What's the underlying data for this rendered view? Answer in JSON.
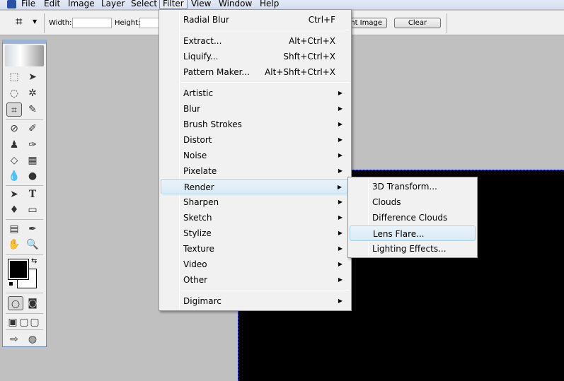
{
  "menubar": {
    "items": [
      "File",
      "Edit",
      "Image",
      "Layer",
      "Select",
      "Filter",
      "View",
      "Window",
      "Help"
    ],
    "active": "Filter"
  },
  "options": {
    "width_label": "Width:",
    "height_label": "Height:",
    "width_value": "",
    "height_value": "",
    "front_image_label": "ont Image",
    "clear_label": "Clear"
  },
  "filter_menu": {
    "top": [
      {
        "label": "Radial Blur",
        "shortcut": "Ctrl+F"
      }
    ],
    "group2": [
      {
        "label": "Extract...",
        "shortcut": "Alt+Ctrl+X"
      },
      {
        "label": "Liquify...",
        "shortcut": "Shft+Ctrl+X"
      },
      {
        "label": "Pattern Maker...",
        "shortcut": "Alt+Shft+Ctrl+X"
      }
    ],
    "submenus": [
      "Artistic",
      "Blur",
      "Brush Strokes",
      "Distort",
      "Noise",
      "Pixelate",
      "Render",
      "Sharpen",
      "Sketch",
      "Stylize",
      "Texture",
      "Video",
      "Other"
    ],
    "highlighted": "Render",
    "last": "Digimarc"
  },
  "render_submenu": {
    "items": [
      "3D Transform...",
      "Clouds",
      "Difference Clouds",
      "Lens Flare...",
      "Lighting Effects..."
    ],
    "highlighted": "Lens Flare..."
  },
  "colors": {
    "foreground": "#000000",
    "background": "#ffffff",
    "highlight": "#d9eaf6",
    "canvas": "#000000"
  }
}
